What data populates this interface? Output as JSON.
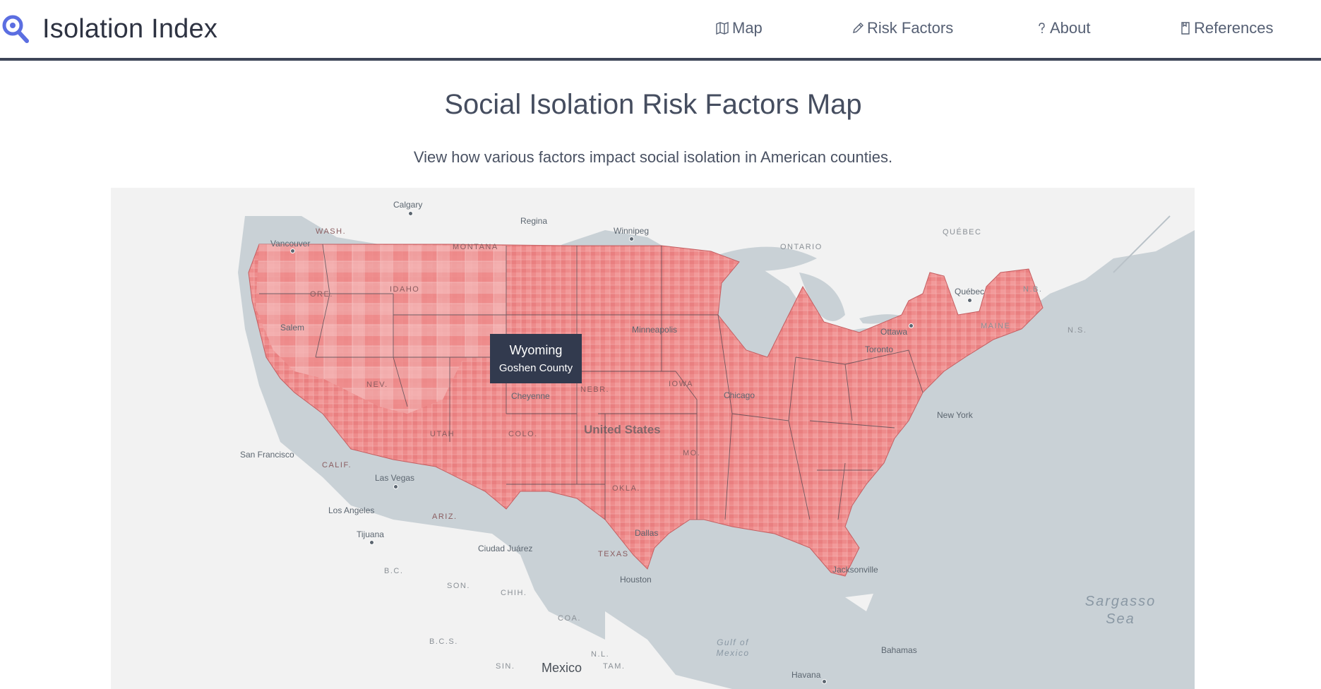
{
  "brand": {
    "title": "Isolation Index",
    "icon": "magnifier-icon"
  },
  "nav": {
    "map": {
      "label": "Map",
      "icon": "map-icon"
    },
    "risk_factors": {
      "label": "Risk Factors",
      "icon": "pencil-icon"
    },
    "about": {
      "label": "About",
      "icon": "question-icon"
    },
    "references": {
      "label": "References",
      "icon": "document-icon"
    }
  },
  "header": {
    "title": "Social Isolation Risk Factors Map",
    "subtitle": "View how various factors impact social isolation in American counties."
  },
  "map": {
    "fill_color": "#ee8b8b",
    "land_color": "#f2f2f2",
    "water_color": "#c9d1d6",
    "tooltip": {
      "state": "Wyoming",
      "county": "Goshen County"
    },
    "labels": {
      "calgary": "Calgary",
      "regina": "Regina",
      "winnipeg": "Winnipeg",
      "vancouver": "Vancouver",
      "ontario": "ONTARIO",
      "quebec_prov": "QUÉBEC",
      "quebec_city": "Québec",
      "nb": "N.B.",
      "ns": "N.S.",
      "maine": "MAINE",
      "ottawa": "Ottawa",
      "toronto": "Toronto",
      "new_york": "New York",
      "montana": "MONTANA",
      "wash": "WASH.",
      "idaho": "IDAHO",
      "ore": "ORE.",
      "nev": "NEV.",
      "utah": "UTAH",
      "colo": "COLO.",
      "calif": "CALIF.",
      "ariz": "ARIZ.",
      "okla": "OKLA.",
      "texas": "TEXAS",
      "iowa": "IOWA",
      "mo": "MO.",
      "nebr": "NEBR.",
      "cheyenne": "Cheyenne",
      "chicago": "Chicago",
      "minneapolis": "Minneapolis",
      "salem": "Salem",
      "sf": "San Francisco",
      "las_vegas": "Las Vegas",
      "la": "Los Angeles",
      "tijuana": "Tijuana",
      "ciudad_juarez": "Ciudad Juárez",
      "dallas": "Dallas",
      "houston": "Houston",
      "jacksonville": "Jacksonville",
      "united_states": "United States",
      "bc": "B.C.",
      "son": "SON.",
      "chih": "CHIH.",
      "bcs": "B.C.S.",
      "coa": "COA.",
      "nl": "N.L.",
      "tam": "TAM.",
      "sin": "SIN.",
      "mexico": "Mexico",
      "gulf": "Gulf of Mexico",
      "bahamas": "Bahamas",
      "havana": "Havana",
      "sargasso": "Sargasso Sea"
    }
  }
}
